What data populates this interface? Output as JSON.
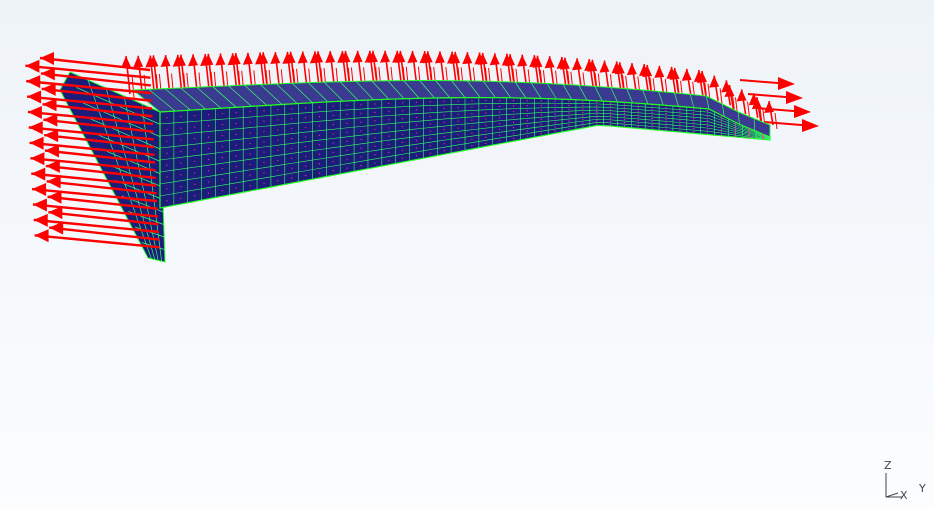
{
  "viewport": {
    "background_top": "#eef3f8",
    "background_bottom": "#fbfdff"
  },
  "model": {
    "shell_fill": "#1c1c7a",
    "mesh_line": "#33ff66",
    "edge_line": "#22ff22",
    "arrow_color": "#ff0000",
    "node_dot": "#ff3399"
  },
  "triad": {
    "z_label": "Z",
    "x_label": "X",
    "y_label": "Y",
    "color": "#444444"
  }
}
